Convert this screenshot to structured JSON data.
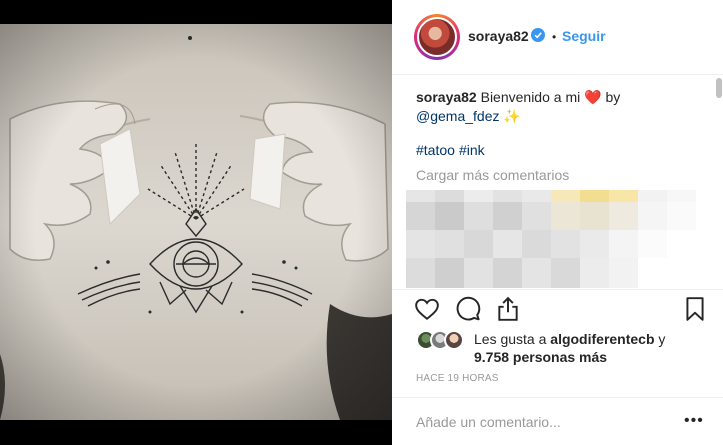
{
  "post": {
    "username": "soraya82",
    "verified": true,
    "follow_label": "Seguir",
    "separator": "•",
    "caption": {
      "username": "soraya82",
      "text_before": " Bienvenido a mi ",
      "emoji_heart": "❤️",
      "text_after": " by",
      "mention": "@gema_fdez",
      "emoji_sparkles": " ✨"
    },
    "hashtags": [
      "#tatoo",
      "#ink"
    ],
    "load_more_label": "Cargar más comentarios",
    "likes": {
      "prefix": "Les gusta a ",
      "user": "algodiferentecb",
      "suffix": " y",
      "others": "9.758 personas más"
    },
    "timestamp": "HACE 19 HORAS",
    "comment_placeholder": "Añade un comentario...",
    "more_label": "•••"
  },
  "icons": {
    "like": "heart-icon",
    "comment": "comment-icon",
    "share": "share-icon",
    "save": "bookmark-icon",
    "verified": "verified-badge-icon"
  },
  "colors": {
    "link": "#3897f0",
    "mention": "#003569",
    "muted": "#999999",
    "text": "#262626"
  }
}
